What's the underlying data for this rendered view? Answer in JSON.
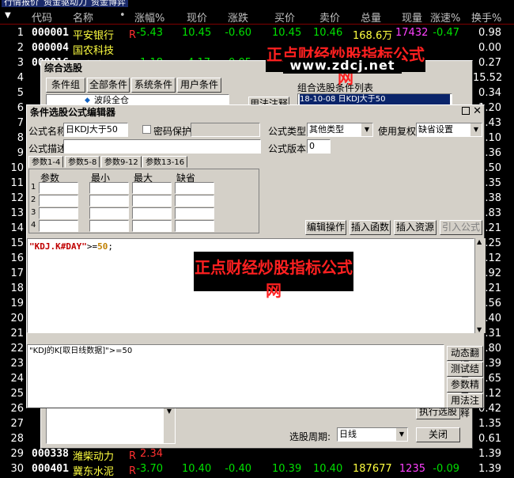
{
  "top_tabs": [
    "行情报价",
    "资金驱动力",
    "资金博弈"
  ],
  "columns": [
    "代码",
    "名称",
    "•",
    "涨幅%",
    "现价",
    "涨跌",
    "买价",
    "卖价",
    "总量",
    "现量",
    "涨速%",
    "换手%"
  ],
  "rows": [
    {
      "idx": "1",
      "code": "000001",
      "name": "平安银行",
      "r": "R",
      "pct": "-5.43",
      "price": "10.45",
      "chg": "-0.60",
      "buy": "10.45",
      "sell": "10.46",
      "vol": "168.6万",
      "now": "17432",
      "speed": "-0.47",
      "turn": "0.98"
    },
    {
      "idx": "2",
      "code": "000004",
      "name": "国农科技",
      "r": "",
      "pct": "",
      "price": "",
      "chg": "",
      "buy": "",
      "sell": "",
      "vol": "",
      "now": "",
      "speed": "",
      "turn": "0.00"
    },
    {
      "idx": "3",
      "code": "000016",
      "name": "深康佳A",
      "r": "",
      "pct": "-1.18",
      "price": "4.17",
      "chg": "-0.05",
      "buy": "",
      "sell": "",
      "vol": "",
      "now": "",
      "speed": "",
      "turn": "0.27"
    },
    {
      "idx": "4",
      "code": "",
      "name": "",
      "r": "",
      "pct": "",
      "price": "",
      "chg": "",
      "buy": "",
      "sell": "",
      "vol": "",
      "now": "",
      "speed": "",
      "turn": "15.52"
    },
    {
      "idx": "5",
      "code": "",
      "name": "",
      "r": "",
      "pct": "",
      "price": "",
      "chg": "",
      "buy": "",
      "sell": "",
      "vol": "",
      "now": "",
      "speed": "",
      "turn": "0.34"
    },
    {
      "idx": "6",
      "code": "",
      "name": "",
      "r": "",
      "pct": "",
      "price": "",
      "chg": "",
      "buy": "",
      "sell": "",
      "vol": "",
      "now": "",
      "speed": "",
      "turn": "1.20"
    },
    {
      "idx": "7",
      "code": "",
      "name": "",
      "r": "",
      "pct": "",
      "price": "",
      "chg": "",
      "buy": "",
      "sell": "",
      "vol": "",
      "now": "",
      "speed": "",
      "turn": "1.43"
    },
    {
      "idx": "8",
      "code": "",
      "name": "",
      "r": "",
      "pct": "",
      "price": "",
      "chg": "",
      "buy": "",
      "sell": "",
      "vol": "",
      "now": "",
      "speed": "",
      "turn": "1.10"
    },
    {
      "idx": "9",
      "code": "",
      "name": "",
      "r": "",
      "pct": "",
      "price": "",
      "chg": "",
      "buy": "",
      "sell": "",
      "vol": "",
      "now": "",
      "speed": "",
      "turn": "0.36"
    },
    {
      "idx": "10",
      "code": "",
      "name": "",
      "r": "",
      "pct": "",
      "price": "",
      "chg": "",
      "buy": "",
      "sell": "",
      "vol": "",
      "now": "",
      "speed": "",
      "turn": "1.50"
    },
    {
      "idx": "11",
      "code": "",
      "name": "",
      "r": "",
      "pct": "",
      "price": "",
      "chg": "",
      "buy": "",
      "sell": "",
      "vol": "",
      "now": "",
      "speed": "",
      "turn": "0.35"
    },
    {
      "idx": "12",
      "code": "",
      "name": "",
      "r": "",
      "pct": "",
      "price": "",
      "chg": "",
      "buy": "",
      "sell": "",
      "vol": "",
      "now": "",
      "speed": "",
      "turn": "0.38"
    },
    {
      "idx": "13",
      "code": "",
      "name": "",
      "r": "",
      "pct": "",
      "price": "",
      "chg": "",
      "buy": "",
      "sell": "",
      "vol": "",
      "now": "",
      "speed": "",
      "turn": "0.83"
    },
    {
      "idx": "14",
      "code": "",
      "name": "",
      "r": "",
      "pct": "",
      "price": "",
      "chg": "",
      "buy": "",
      "sell": "",
      "vol": "",
      "now": "",
      "speed": "",
      "turn": "0.21"
    },
    {
      "idx": "15",
      "code": "",
      "name": "",
      "r": "",
      "pct": "",
      "price": "",
      "chg": "",
      "buy": "",
      "sell": "",
      "vol": "",
      "now": "",
      "speed": "",
      "turn": "1.25"
    },
    {
      "idx": "16",
      "code": "",
      "name": "",
      "r": "",
      "pct": "",
      "price": "",
      "chg": "",
      "buy": "",
      "sell": "",
      "vol": "",
      "now": "",
      "speed": "",
      "turn": "0.12"
    },
    {
      "idx": "17",
      "code": "",
      "name": "",
      "r": "",
      "pct": "",
      "price": "",
      "chg": "",
      "buy": "",
      "sell": "",
      "vol": "",
      "now": "",
      "speed": "",
      "turn": "0.92"
    },
    {
      "idx": "18",
      "code": "",
      "name": "",
      "r": "",
      "pct": "",
      "price": "",
      "chg": "",
      "buy": "",
      "sell": "",
      "vol": "",
      "now": "",
      "speed": "",
      "turn": "0.21"
    },
    {
      "idx": "19",
      "code": "",
      "name": "",
      "r": "",
      "pct": "",
      "price": "",
      "chg": "",
      "buy": "",
      "sell": "",
      "vol": "",
      "now": "",
      "speed": "",
      "turn": "0.56"
    },
    {
      "idx": "20",
      "code": "",
      "name": "",
      "r": "",
      "pct": "",
      "price": "",
      "chg": "",
      "buy": "",
      "sell": "",
      "vol": "",
      "now": "",
      "speed": "",
      "turn": "0.40"
    },
    {
      "idx": "21",
      "code": "",
      "name": "",
      "r": "",
      "pct": "",
      "price": "",
      "chg": "",
      "buy": "",
      "sell": "",
      "vol": "",
      "now": "",
      "speed": "",
      "turn": "0.31"
    },
    {
      "idx": "22",
      "code": "",
      "name": "",
      "r": "",
      "pct": "",
      "price": "",
      "chg": "",
      "buy": "",
      "sell": "",
      "vol": "",
      "now": "",
      "speed": "",
      "turn": "0.80"
    },
    {
      "idx": "23",
      "code": "",
      "name": "",
      "r": "",
      "pct": "",
      "price": "",
      "chg": "",
      "buy": "",
      "sell": "",
      "vol": "",
      "now": "",
      "speed": "",
      "turn": "0.39"
    },
    {
      "idx": "24",
      "code": "",
      "name": "",
      "r": "",
      "pct": "",
      "price": "",
      "chg": "",
      "buy": "",
      "sell": "",
      "vol": "",
      "now": "",
      "speed": "",
      "turn": "1.65"
    },
    {
      "idx": "25",
      "code": "",
      "name": "",
      "r": "",
      "pct": "",
      "price": "",
      "chg": "",
      "buy": "",
      "sell": "",
      "vol": "",
      "now": "",
      "speed": "",
      "turn": "0.12"
    },
    {
      "idx": "26",
      "code": "",
      "name": "",
      "r": "",
      "pct": "",
      "price": "",
      "chg": "",
      "buy": "",
      "sell": "",
      "vol": "",
      "now": "",
      "speed": "",
      "turn": "0.42"
    },
    {
      "idx": "27",
      "code": "",
      "name": "",
      "r": "",
      "pct": "",
      "price": "",
      "chg": "",
      "buy": "",
      "sell": "",
      "vol": "",
      "now": "",
      "speed": "",
      "turn": "1.35"
    },
    {
      "idx": "28",
      "code": "",
      "name": "",
      "r": "",
      "pct": "",
      "price": "",
      "chg": "",
      "buy": "",
      "sell": "",
      "vol": "",
      "now": "",
      "speed": "",
      "turn": "0.61"
    },
    {
      "idx": "29",
      "code": "000338",
      "name": "潍柴动力",
      "r": "R",
      "pct": "2.34",
      "price": "",
      "chg": "",
      "buy": "",
      "sell": "",
      "vol": "",
      "now": "",
      "speed": "",
      "turn": "1.39"
    },
    {
      "idx": "30",
      "code": "000401",
      "name": "冀东水泥",
      "r": "R",
      "pct": "-3.70",
      "price": "10.40",
      "chg": "-0.40",
      "buy": "10.39",
      "sell": "10.40",
      "vol": "187677",
      "now": "1235",
      "speed": "-0.09",
      "turn": "1.39"
    }
  ],
  "outer_dialog": {
    "title": "综合选股",
    "tabs": [
      "条件组",
      "全部条件",
      "系统条件",
      "用户条件"
    ],
    "tree_item": "波段全仓",
    "usage_btn": "用法注释",
    "list_title": "组合选股条件列表",
    "list_item": "18-10-08 日KDJ大于50",
    "exec_btn": "执行选股",
    "period_label": "选股周期:",
    "period_value": "日线",
    "close_btn": "关闭",
    "watermark_1": "正点财经炒股指标公式网",
    "watermark_2": "www.zdcj.net"
  },
  "editor": {
    "title": "条件选股公式编辑器",
    "name_label": "公式名称",
    "name_value": "日KDJ大于50",
    "pwd_label": "密码保护",
    "desc_label": "公式描述",
    "type_label": "公式类型",
    "type_value": "其他类型",
    "reuse_label": "使用复权",
    "reuse_value": "缺省设置",
    "version_label": "公式版本",
    "version_value": "0",
    "param_tabs": [
      "参数1-4",
      "参数5-8",
      "参数9-12",
      "参数13-16"
    ],
    "param_headers": [
      "参数",
      "最小",
      "最大",
      "缺省"
    ],
    "param_rows": [
      "1",
      "2",
      "3",
      "4"
    ],
    "btn_edit": "编辑操作",
    "btn_insert_fn": "插入函数",
    "btn_insert_res": "插入资源",
    "btn_import": "引入公式",
    "code_str": "\"KDJ.K#DAY\"",
    "code_op": ">=",
    "code_num": "50",
    "code_end": ";",
    "watermark_1": "正点财经炒股指标公式网",
    "watermark_2": "www.zdcj.net",
    "translation": "\"KDJ的K[取日线数据]\">=50",
    "side_btns": [
      "动态翻译",
      "测试结果",
      "参数精灵",
      "用法注释"
    ]
  }
}
